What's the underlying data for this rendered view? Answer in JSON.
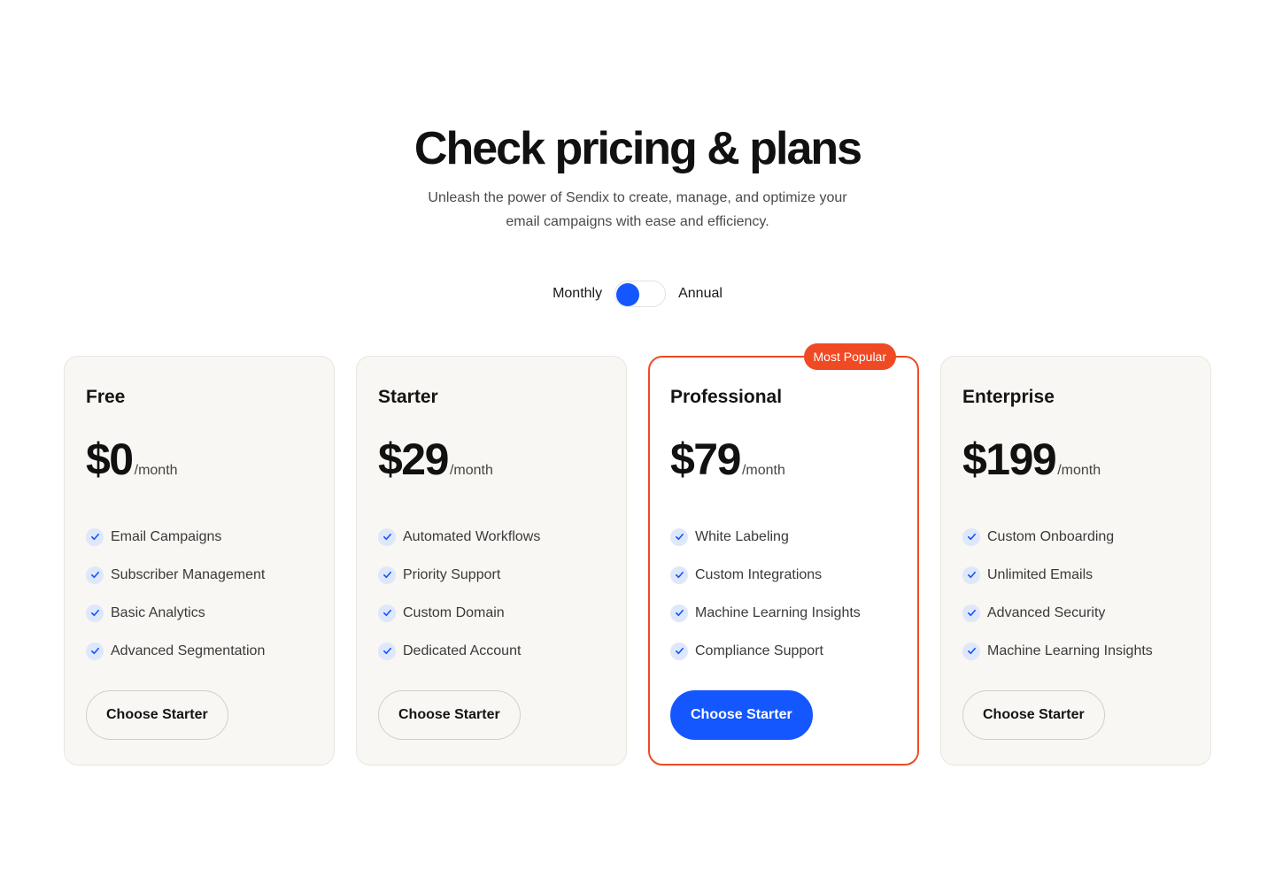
{
  "header": {
    "title": "Check pricing & plans",
    "subtitle": "Unleash the power of Sendix to create, manage, and optimize your email campaigns with ease and efficiency."
  },
  "billing_toggle": {
    "left_label": "Monthly",
    "right_label": "Annual",
    "selected": "Monthly",
    "knob_color": "#1457ff"
  },
  "colors": {
    "accent": "#1457ff",
    "highlight": "#f04a24",
    "card_background": "#f8f7f3",
    "check_background": "#dfe7fb"
  },
  "icons": {
    "feature_check": "check-icon"
  },
  "plans": [
    {
      "name": "Free",
      "price": "$0",
      "period": "/month",
      "features": [
        "Email Campaigns",
        "Subscriber Management",
        "Basic Analytics",
        "Advanced Segmentation"
      ],
      "cta": "Choose Starter"
    },
    {
      "name": "Starter",
      "price": "$29",
      "period": "/month",
      "features": [
        "Automated Workflows",
        "Priority Support",
        "Custom Domain",
        "Dedicated Account"
      ],
      "cta": "Choose Starter"
    },
    {
      "name": "Professional",
      "price": "$79",
      "period": "/month",
      "badge": "Most Popular",
      "features": [
        "White Labeling",
        "Custom Integrations",
        "Machine Learning Insights",
        "Compliance Support"
      ],
      "cta": "Choose Starter"
    },
    {
      "name": "Enterprise",
      "price": "$199",
      "period": "/month",
      "features": [
        "Custom Onboarding",
        "Unlimited Emails",
        "Advanced Security",
        "Machine Learning Insights"
      ],
      "cta": "Choose Starter"
    }
  ]
}
